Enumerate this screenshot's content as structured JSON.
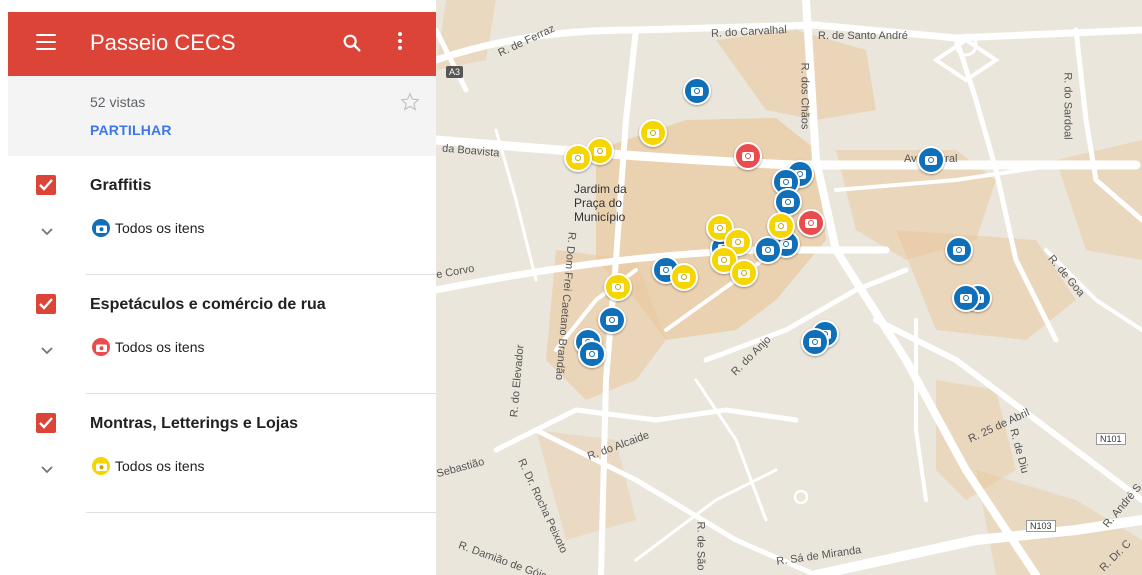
{
  "header": {
    "title": "Passeio CECS",
    "bg_color": "#db4437"
  },
  "info": {
    "views": "52 vistas",
    "share_label": "PARTILHAR"
  },
  "layers": [
    {
      "name": "Graffitis",
      "item_label": "Todos os itens",
      "icon_color": "#0f6fb8"
    },
    {
      "name": "Espetáculos e comércio de rua",
      "item_label": "Todos os itens",
      "icon_color": "#e84c4c"
    },
    {
      "name": "Montras, Letterings e Lojas",
      "item_label": "Todos os itens",
      "icon_color": "#f5d600"
    }
  ],
  "map": {
    "streets": [
      "R. de Ferraz",
      "R. do Carvalhal",
      "R. de Santo André",
      "R. dos Chãos",
      "R. do Sardoal",
      "da Boavista",
      "Av. Central",
      "e Corvo",
      "R. Dom Frei Caetano Brandão",
      "R. do Elevador",
      "R. do Anjo",
      "R. de Goa",
      "R. 25 de Abril",
      "R. de Diu",
      "R. do Alcaide",
      "Sebastião",
      "R. Dr. Rocha Peixoto",
      "R. Damião de Góis",
      "R. de São",
      "R. Sá de Miranda",
      "R. André S",
      "R. Dr. C"
    ],
    "poi": "Jardim da Praça do Município",
    "road_shields": [
      "A3",
      "N101",
      "N103"
    ]
  }
}
